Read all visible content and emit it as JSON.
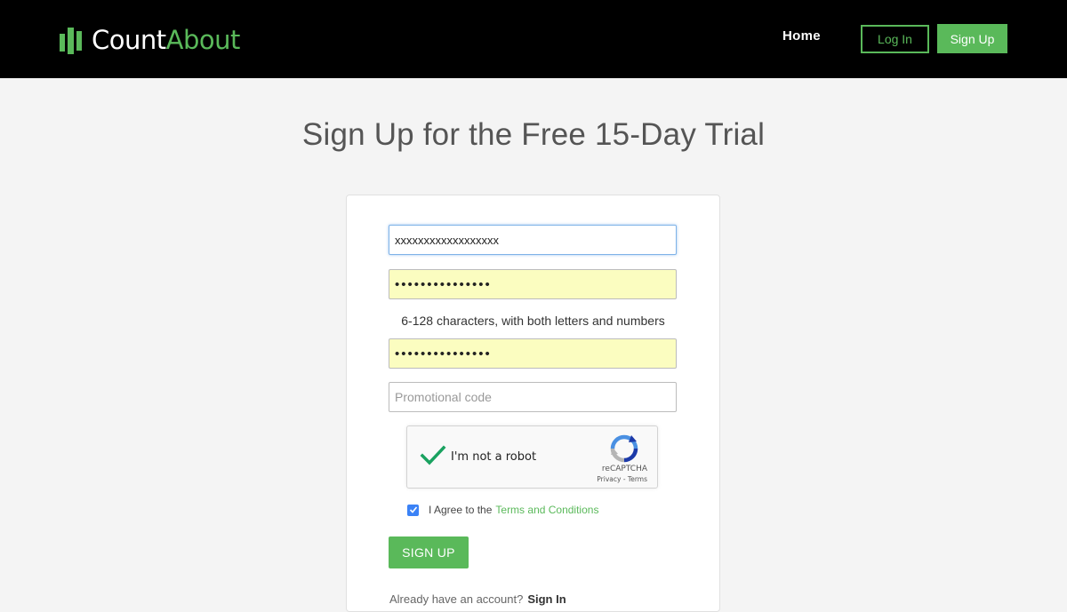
{
  "brand": {
    "logo_text_1": "Count",
    "logo_text_2": "About",
    "accent_color": "#5ab95a"
  },
  "nav": {
    "home_label": "Home",
    "login_label": "Log In",
    "signup_label": "Sign Up"
  },
  "page": {
    "title": "Sign Up for the Free 15-Day Trial"
  },
  "form": {
    "email_value": "xxxxxxxxxxxxxxxxxx",
    "password_value": "•••••••••••••••",
    "password_hint": "6-128 characters, with both letters and numbers",
    "confirm_password_value": "•••••••••••••••",
    "promo_placeholder": "Promotional code",
    "submit_label": "SIGN UP"
  },
  "recaptcha": {
    "label": "I'm not a robot",
    "brand": "reCAPTCHA",
    "links": "Privacy - Terms",
    "checked": true
  },
  "agreement": {
    "checked": true,
    "prefix": "I Agree to the",
    "link_label": "Terms and Conditions"
  },
  "footer": {
    "already_text": "Already have an account?",
    "signin_label": "Sign In"
  }
}
